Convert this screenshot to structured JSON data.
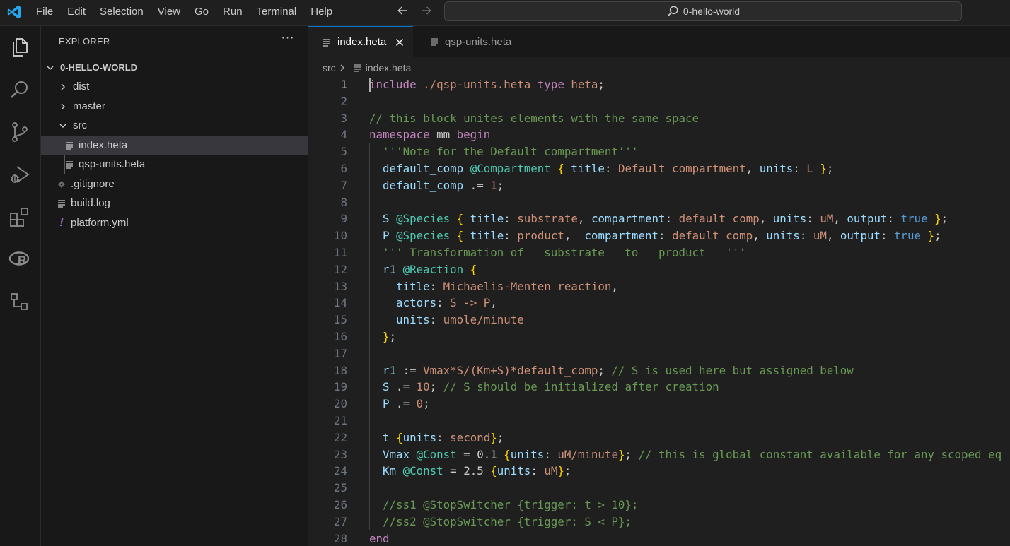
{
  "titlebar": {
    "menu": [
      "File",
      "Edit",
      "Selection",
      "View",
      "Go",
      "Run",
      "Terminal",
      "Help"
    ],
    "search_label": "0-hello-world",
    "accent_color": "#0078d4"
  },
  "activity_bar": {
    "icons": [
      "explorer-icon",
      "search-icon",
      "source-control-icon",
      "run-debug-icon",
      "extensions-icon",
      "r-language-icon",
      "remote-explorer-icon"
    ]
  },
  "sidebar": {
    "title": "EXPLORER",
    "more_label": "···",
    "root_label": "0-HELLO-WORLD",
    "items": [
      {
        "label": "dist",
        "type": "folder",
        "expanded": false
      },
      {
        "label": "master",
        "type": "folder",
        "expanded": false
      },
      {
        "label": "src",
        "type": "folder",
        "expanded": true
      },
      {
        "label": "index.heta",
        "type": "file",
        "selected": true
      },
      {
        "label": "qsp-units.heta",
        "type": "file"
      },
      {
        "label": ".gitignore",
        "type": "file"
      },
      {
        "label": "build.log",
        "type": "file"
      },
      {
        "label": "platform.yml",
        "type": "file"
      }
    ]
  },
  "editor": {
    "tabs": [
      {
        "label": "index.heta",
        "active": true
      },
      {
        "label": "qsp-units.heta",
        "active": false
      }
    ],
    "breadcrumb": {
      "folder": "src",
      "file": "index.heta"
    },
    "current_line": 1,
    "lines": [
      [
        [
          "kw",
          "include"
        ],
        [
          "plain",
          " "
        ],
        [
          "str",
          "./qsp-units.heta"
        ],
        [
          "plain",
          " "
        ],
        [
          "kw",
          "type"
        ],
        [
          "plain",
          " "
        ],
        [
          "str",
          "heta"
        ],
        [
          "plain",
          ";"
        ]
      ],
      [],
      [
        [
          "comment",
          "// this block unites elements with the same space"
        ]
      ],
      [
        [
          "kw",
          "namespace"
        ],
        [
          "plain",
          " mm "
        ],
        [
          "kw",
          "begin"
        ]
      ],
      [
        [
          "plain",
          "  "
        ],
        [
          "comment",
          "'''Note for the Default compartment'''"
        ]
      ],
      [
        [
          "plain",
          "  "
        ],
        [
          "id",
          "default_comp"
        ],
        [
          "plain",
          " "
        ],
        [
          "class",
          "@Compartment"
        ],
        [
          "plain",
          " "
        ],
        [
          "brace",
          "{"
        ],
        [
          "plain",
          " "
        ],
        [
          "prop",
          "title"
        ],
        [
          "plain",
          ": "
        ],
        [
          "str",
          "Default compartment"
        ],
        [
          "plain",
          ", "
        ],
        [
          "prop",
          "units"
        ],
        [
          "plain",
          ": "
        ],
        [
          "str",
          "L"
        ],
        [
          "plain",
          " "
        ],
        [
          "brace",
          "}"
        ],
        [
          "plain",
          ";"
        ]
      ],
      [
        [
          "plain",
          "  "
        ],
        [
          "id",
          "default_comp"
        ],
        [
          "plain",
          " .= "
        ],
        [
          "num",
          "1"
        ],
        [
          "plain",
          ";"
        ]
      ],
      [],
      [
        [
          "plain",
          "  "
        ],
        [
          "id",
          "S"
        ],
        [
          "plain",
          " "
        ],
        [
          "class",
          "@Species"
        ],
        [
          "plain",
          " "
        ],
        [
          "brace",
          "{"
        ],
        [
          "plain",
          " "
        ],
        [
          "prop",
          "title"
        ],
        [
          "plain",
          ": "
        ],
        [
          "str",
          "substrate"
        ],
        [
          "plain",
          ", "
        ],
        [
          "prop",
          "compartment"
        ],
        [
          "plain",
          ": "
        ],
        [
          "str",
          "default_comp"
        ],
        [
          "plain",
          ", "
        ],
        [
          "prop",
          "units"
        ],
        [
          "plain",
          ": "
        ],
        [
          "str",
          "uM"
        ],
        [
          "plain",
          ", "
        ],
        [
          "prop",
          "output"
        ],
        [
          "plain",
          ": "
        ],
        [
          "bool",
          "true"
        ],
        [
          "plain",
          " "
        ],
        [
          "brace",
          "}"
        ],
        [
          "plain",
          ";"
        ]
      ],
      [
        [
          "plain",
          "  "
        ],
        [
          "id",
          "P"
        ],
        [
          "plain",
          " "
        ],
        [
          "class",
          "@Species"
        ],
        [
          "plain",
          " "
        ],
        [
          "brace",
          "{"
        ],
        [
          "plain",
          " "
        ],
        [
          "prop",
          "title"
        ],
        [
          "plain",
          ": "
        ],
        [
          "str",
          "product"
        ],
        [
          "plain",
          ",  "
        ],
        [
          "prop",
          "compartment"
        ],
        [
          "plain",
          ": "
        ],
        [
          "str",
          "default_comp"
        ],
        [
          "plain",
          ", "
        ],
        [
          "prop",
          "units"
        ],
        [
          "plain",
          ": "
        ],
        [
          "str",
          "uM"
        ],
        [
          "plain",
          ", "
        ],
        [
          "prop",
          "output"
        ],
        [
          "plain",
          ": "
        ],
        [
          "bool",
          "true"
        ],
        [
          "plain",
          " "
        ],
        [
          "brace",
          "}"
        ],
        [
          "plain",
          ";"
        ]
      ],
      [
        [
          "plain",
          "  "
        ],
        [
          "comment",
          "''' Transformation of __substrate__ to __product__ '''"
        ]
      ],
      [
        [
          "plain",
          "  "
        ],
        [
          "id",
          "r1"
        ],
        [
          "plain",
          " "
        ],
        [
          "class",
          "@Reaction"
        ],
        [
          "plain",
          " "
        ],
        [
          "brace",
          "{"
        ]
      ],
      [
        [
          "plain",
          "    "
        ],
        [
          "prop",
          "title"
        ],
        [
          "plain",
          ": "
        ],
        [
          "str",
          "Michaelis-Menten reaction"
        ],
        [
          "plain",
          ","
        ]
      ],
      [
        [
          "plain",
          "    "
        ],
        [
          "prop",
          "actors"
        ],
        [
          "plain",
          ": "
        ],
        [
          "str",
          "S -> P"
        ],
        [
          "plain",
          ","
        ]
      ],
      [
        [
          "plain",
          "    "
        ],
        [
          "prop",
          "units"
        ],
        [
          "plain",
          ": "
        ],
        [
          "str",
          "umole/minute"
        ]
      ],
      [
        [
          "plain",
          "  "
        ],
        [
          "brace",
          "}"
        ],
        [
          "plain",
          ";"
        ]
      ],
      [],
      [
        [
          "plain",
          "  "
        ],
        [
          "id",
          "r1"
        ],
        [
          "plain",
          " := "
        ],
        [
          "str",
          "Vmax*S/(Km+S)*default_comp"
        ],
        [
          "plain",
          "; "
        ],
        [
          "comment",
          "// S is used here but assigned below"
        ]
      ],
      [
        [
          "plain",
          "  "
        ],
        [
          "id",
          "S"
        ],
        [
          "plain",
          " .= "
        ],
        [
          "num",
          "10"
        ],
        [
          "plain",
          "; "
        ],
        [
          "comment",
          "// S should be initialized after creation"
        ]
      ],
      [
        [
          "plain",
          "  "
        ],
        [
          "id",
          "P"
        ],
        [
          "plain",
          " .= "
        ],
        [
          "num",
          "0"
        ],
        [
          "plain",
          ";"
        ]
      ],
      [],
      [
        [
          "plain",
          "  "
        ],
        [
          "id",
          "t"
        ],
        [
          "plain",
          " "
        ],
        [
          "brace",
          "{"
        ],
        [
          "prop",
          "units"
        ],
        [
          "plain",
          ": "
        ],
        [
          "str",
          "second"
        ],
        [
          "brace",
          "}"
        ],
        [
          "plain",
          ";"
        ]
      ],
      [
        [
          "plain",
          "  "
        ],
        [
          "id",
          "Vmax"
        ],
        [
          "plain",
          " "
        ],
        [
          "class",
          "@Const"
        ],
        [
          "plain",
          " = 0.1 "
        ],
        [
          "brace",
          "{"
        ],
        [
          "prop",
          "units"
        ],
        [
          "plain",
          ": "
        ],
        [
          "str",
          "uM/minute"
        ],
        [
          "brace",
          "}"
        ],
        [
          "plain",
          "; "
        ],
        [
          "comment",
          "// this is global constant available for any scoped eq"
        ]
      ],
      [
        [
          "plain",
          "  "
        ],
        [
          "id",
          "Km"
        ],
        [
          "plain",
          " "
        ],
        [
          "class",
          "@Const"
        ],
        [
          "plain",
          " = 2.5 "
        ],
        [
          "brace",
          "{"
        ],
        [
          "prop",
          "units"
        ],
        [
          "plain",
          ": "
        ],
        [
          "str",
          "uM"
        ],
        [
          "brace",
          "}"
        ],
        [
          "plain",
          ";"
        ]
      ],
      [],
      [
        [
          "plain",
          "  "
        ],
        [
          "comment",
          "//ss1 @StopSwitcher {trigger: t > 10};"
        ]
      ],
      [
        [
          "plain",
          "  "
        ],
        [
          "comment",
          "//ss2 @StopSwitcher {trigger: S < P};"
        ]
      ],
      [
        [
          "kw",
          "end"
        ]
      ]
    ]
  }
}
